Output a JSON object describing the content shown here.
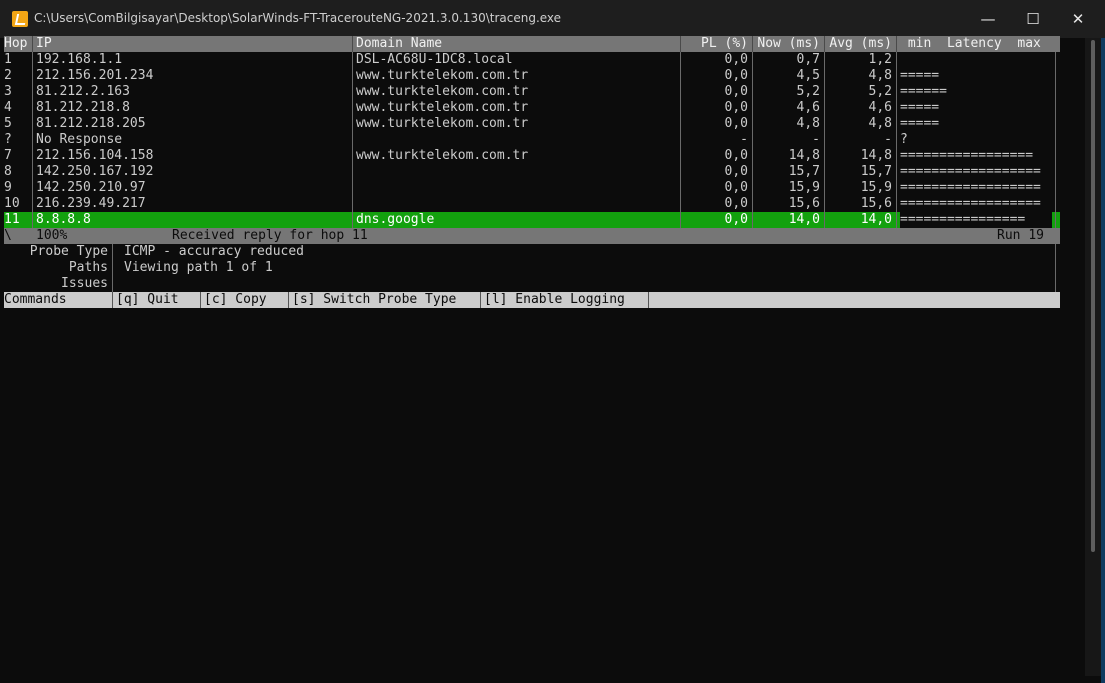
{
  "window": {
    "title": "C:\\Users\\ComBilgisayar\\Desktop\\SolarWinds-FT-TracerouteNG-2021.3.0.130\\traceng.exe",
    "minimize_glyph": "—",
    "maximize_glyph": "☐",
    "close_glyph": "✕",
    "app_icon": "solarwinds-icon"
  },
  "table": {
    "headers": {
      "hop": "Hop",
      "ip": "IP",
      "domain": "Domain Name",
      "pl": "PL (%)",
      "now": "Now (ms)",
      "avg": "Avg (ms)",
      "latency": " min  Latency  max"
    },
    "rows": [
      {
        "hop": "1",
        "ip": "192.168.1.1",
        "domain": "DSL-AC68U-1DC8.local",
        "pl": "0,0",
        "now": "0,7",
        "avg": "1,2",
        "bar": ""
      },
      {
        "hop": "2",
        "ip": "212.156.201.234",
        "domain": "www.turktelekom.com.tr",
        "pl": "0,0",
        "now": "4,5",
        "avg": "4,8",
        "bar": "====="
      },
      {
        "hop": "3",
        "ip": "81.212.2.163",
        "domain": "www.turktelekom.com.tr",
        "pl": "0,0",
        "now": "5,2",
        "avg": "5,2",
        "bar": "======"
      },
      {
        "hop": "4",
        "ip": "81.212.218.8",
        "domain": "www.turktelekom.com.tr",
        "pl": "0,0",
        "now": "4,6",
        "avg": "4,6",
        "bar": "====="
      },
      {
        "hop": "5",
        "ip": "81.212.218.205",
        "domain": "www.turktelekom.com.tr",
        "pl": "0,0",
        "now": "4,8",
        "avg": "4,8",
        "bar": "====="
      },
      {
        "hop": "?",
        "ip": "No Response",
        "domain": "",
        "pl": "-",
        "now": "-",
        "avg": "-",
        "bar": "?"
      },
      {
        "hop": "7",
        "ip": "212.156.104.158",
        "domain": "www.turktelekom.com.tr",
        "pl": "0,0",
        "now": "14,8",
        "avg": "14,8",
        "bar": "================="
      },
      {
        "hop": "8",
        "ip": "142.250.167.192",
        "domain": "",
        "pl": "0,0",
        "now": "15,7",
        "avg": "15,7",
        "bar": "=================="
      },
      {
        "hop": "9",
        "ip": "142.250.210.97",
        "domain": "",
        "pl": "0,0",
        "now": "15,9",
        "avg": "15,9",
        "bar": "=================="
      },
      {
        "hop": "10",
        "ip": "216.239.49.217",
        "domain": "",
        "pl": "0,0",
        "now": "15,6",
        "avg": "15,6",
        "bar": "=================="
      },
      {
        "hop": "11",
        "ip": "8.8.8.8",
        "domain": "dns.google",
        "pl": "0,0",
        "now": "14,0",
        "avg": "14,0",
        "bar": "================"
      }
    ],
    "selected_hop": "11"
  },
  "status": {
    "spinner": "\\",
    "percent": "100%",
    "message": "Received reply for hop 11",
    "run": "Run 19"
  },
  "info": [
    {
      "label": "Probe Type",
      "value": "ICMP - accuracy reduced"
    },
    {
      "label": "Paths",
      "value": "Viewing path 1 of 1"
    },
    {
      "label": "Issues",
      "value": ""
    }
  ],
  "commands": {
    "label": "Commands",
    "items": [
      {
        "text": "[q] Quit"
      },
      {
        "text": "[c] Copy"
      },
      {
        "text": "[s] Switch Probe Type"
      },
      {
        "text": "[l] Enable Logging"
      }
    ]
  }
}
